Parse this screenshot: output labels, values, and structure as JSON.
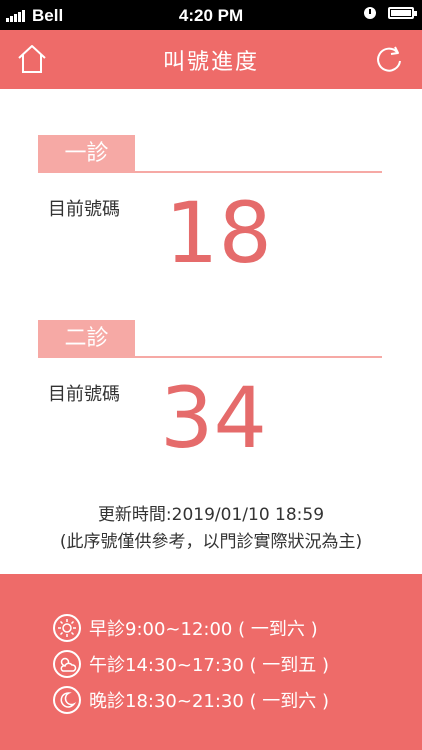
{
  "status_bar": {
    "carrier": "Bell",
    "time": "4:20 PM"
  },
  "header": {
    "title": "叫號進度"
  },
  "clinics": [
    {
      "name": "一診",
      "label": "目前號碼",
      "number": "18"
    },
    {
      "name": "二診",
      "label": "目前號碼",
      "number": "34"
    }
  ],
  "update": {
    "time_text": "更新時間:2019/01/10 18:59",
    "note": "(此序號僅供參考，以門診實際狀況為主)"
  },
  "hours": [
    {
      "icon": "sun-icon",
      "text": "早診9:00~12:00 ( 一到六 )"
    },
    {
      "icon": "partly-cloudy-icon",
      "text": "午診14:30~17:30 ( 一到五 )"
    },
    {
      "icon": "moon-icon",
      "text": "晚診18:30~21:30 ( 一到六 )"
    }
  ],
  "colors": {
    "primary": "#ee6b69",
    "tab": "#f6a9a5",
    "number": "#e56b6b"
  }
}
